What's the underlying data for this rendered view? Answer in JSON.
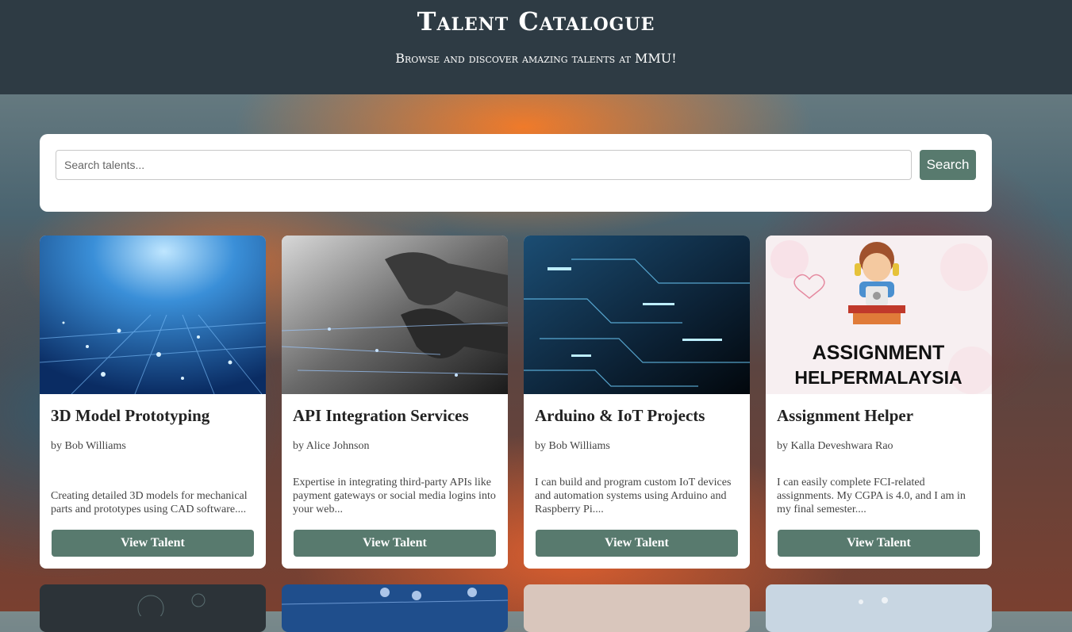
{
  "header": {
    "title": "Talent Catalogue",
    "subtitle": "Browse and discover amazing talents at MMU!"
  },
  "search": {
    "placeholder": "Search talents...",
    "value": "",
    "button_label": "Search"
  },
  "cards": [
    {
      "title": "3D Model Prototyping",
      "author": "by Bob Williams",
      "description": "Creating detailed 3D models for mechanical parts and prototypes using CAD software....",
      "button_label": "View Talent",
      "image": "blue-circuit-board"
    },
    {
      "title": "API Integration Services",
      "author": "by Alice Johnson",
      "description": "Expertise in integrating third-party APIs like payment gateways or social media logins into your web...",
      "button_label": "View Talent",
      "image": "hands-typing-on-keyboard"
    },
    {
      "title": "Arduino & IoT Projects",
      "author": "by Bob Williams",
      "description": "I can build and program custom IoT devices and automation systems using Arduino and Raspberry Pi....",
      "button_label": "View Talent",
      "image": "dark-circuit-data"
    },
    {
      "title": "Assignment Helper",
      "author": "by Kalla Deveshwara Rao",
      "description": "I can easily complete FCI-related assignments. My CGPA is 4.0, and I am in my final semester....",
      "button_label": "View Talent",
      "image": "assignment-helper-logo",
      "image_text": [
        "ASSIGNMENT",
        "HELPERMALAYSIA"
      ]
    }
  ],
  "colors": {
    "header_bg": "#2e3b44",
    "accent": "#587a6e",
    "card_bg": "#ffffff"
  }
}
